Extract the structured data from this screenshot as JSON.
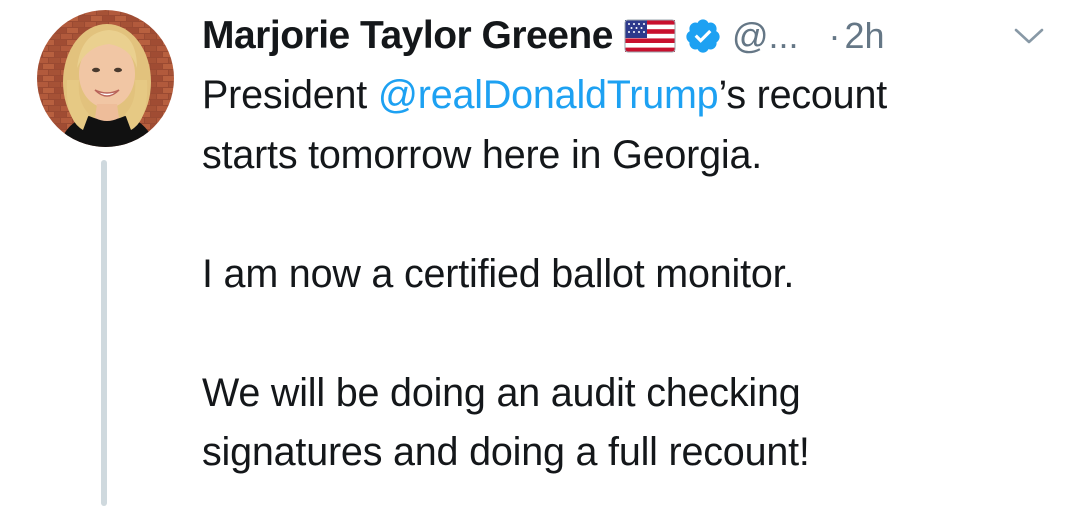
{
  "tweet": {
    "author": {
      "display_name": "Marjorie Taylor Greene",
      "handle": "@...",
      "avatar": "avatar-photo",
      "flag_icon": "us-flag-icon",
      "verified_icon": "verified-badge-icon"
    },
    "time_separator": "·",
    "timestamp": "2h",
    "menu_icon": "chevron-down-icon",
    "body": {
      "line1_prefix": "President ",
      "mention": "@realDonaldTrump",
      "line1_suffix": "’s recount",
      "line2": "starts tomorrow here in Georgia.",
      "paragraph2": "I am now a certified ballot monitor.",
      "paragraph3_line1": "We will be doing an audit checking",
      "paragraph3_line2": "signatures and doing a full recount!"
    },
    "colors": {
      "text": "#14171a",
      "link": "#1da1f2",
      "muted": "#657786",
      "verified": "#1da1f2",
      "thread_line": "#cfd9de"
    }
  }
}
